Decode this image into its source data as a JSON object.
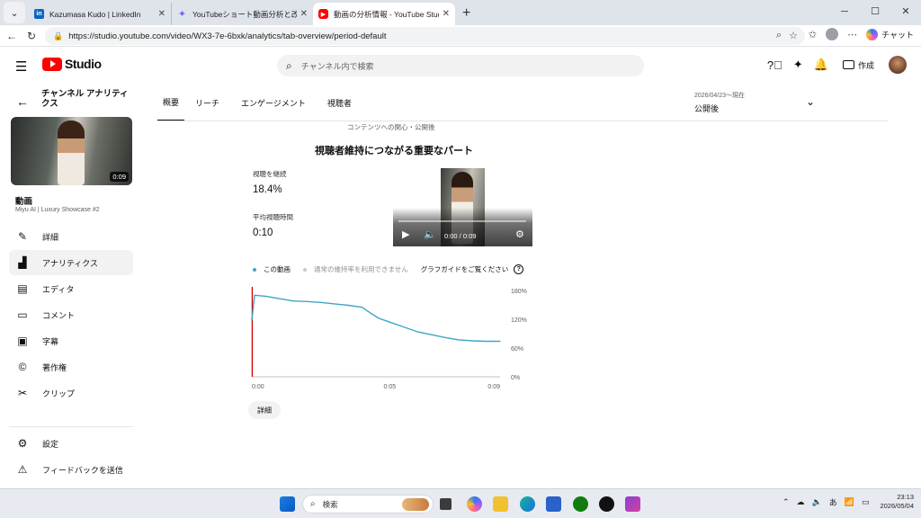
{
  "browser": {
    "tabs": [
      {
        "title": "Kazumasa Kudo | LinkedIn",
        "favicon": "linkedin-icon",
        "color": "#0a66c2"
      },
      {
        "title": "YouTubeショート動画分析と改善提案",
        "favicon": "sparkle-icon",
        "color": "#8c6cf0"
      },
      {
        "title": "動画の分析情報 - YouTube Studio",
        "favicon": "youtube-icon",
        "color": "#ff0000"
      }
    ],
    "url": "https://studio.youtube.com/video/WX3-7e-6bxk/analytics/tab-overview/period-default",
    "copilot_label": "チャット"
  },
  "header": {
    "logo_text": "Studio",
    "search_placeholder": "チャンネル内で検索",
    "create_label": "作成"
  },
  "sidebar": {
    "title": "チャンネル アナリティクス",
    "video_duration": "0:09",
    "video_label": "動画",
    "video_title": "Miyu AI | Luxury Showcase #2",
    "nav": [
      {
        "label": "詳細",
        "icon": "pencil-icon"
      },
      {
        "label": "アナリティクス",
        "icon": "analytics-icon",
        "active": true
      },
      {
        "label": "エディタ",
        "icon": "editor-icon"
      },
      {
        "label": "コメント",
        "icon": "comment-icon"
      },
      {
        "label": "字幕",
        "icon": "subtitles-icon"
      },
      {
        "label": "著作権",
        "icon": "copyright-icon"
      },
      {
        "label": "クリップ",
        "icon": "scissors-icon"
      }
    ],
    "bottom": [
      {
        "label": "設定",
        "icon": "gear-icon"
      },
      {
        "label": "フィードバックを送信",
        "icon": "feedback-icon"
      }
    ]
  },
  "main": {
    "tabs": [
      "概要",
      "リーチ",
      "エンゲージメント",
      "視聴者"
    ],
    "date_range": "2026/04/23～現在",
    "period": "公開後",
    "cutoff_text": "コンテンツへの関心・公開後",
    "card_title": "視聴者維持につながる重要なパート",
    "metrics": [
      {
        "label": "視聴を継続",
        "value": "18.4%"
      },
      {
        "label": "平均視聴時間",
        "value": "0:10"
      }
    ],
    "player": {
      "time": "0:00 / 0:09"
    },
    "legend": {
      "this_video": "この動画",
      "typical": "通常の維持率を利用できません",
      "guide": "グラフガイドをご覧ください"
    },
    "details_button": "詳細"
  },
  "chart_data": {
    "type": "line",
    "title": "",
    "xlabel": "",
    "ylabel": "",
    "x_ticks": [
      "0:00",
      "0:05",
      "0:09"
    ],
    "y_ticks": [
      "180%",
      "120%",
      "60%",
      "0%"
    ],
    "ylim": [
      0,
      180
    ],
    "xlim": [
      0,
      9
    ],
    "series": [
      {
        "name": "この動画",
        "color": "#3ea6c4",
        "x": [
          0,
          0.1,
          0.5,
          1,
          1.5,
          2,
          2.5,
          3,
          3.5,
          4,
          4.3,
          4.6,
          5,
          5.5,
          6,
          6.5,
          7,
          7.5,
          8,
          8.5,
          9
        ],
        "y": [
          118,
          170,
          168,
          163,
          158,
          157,
          155,
          152,
          149,
          145,
          133,
          122,
          114,
          104,
          94,
          88,
          82,
          77,
          75,
          74,
          74
        ]
      }
    ],
    "grid": false
  },
  "taskbar": {
    "search_placeholder": "検索",
    "ime": "あ",
    "time": "23:13",
    "date": "2026/05/04"
  }
}
